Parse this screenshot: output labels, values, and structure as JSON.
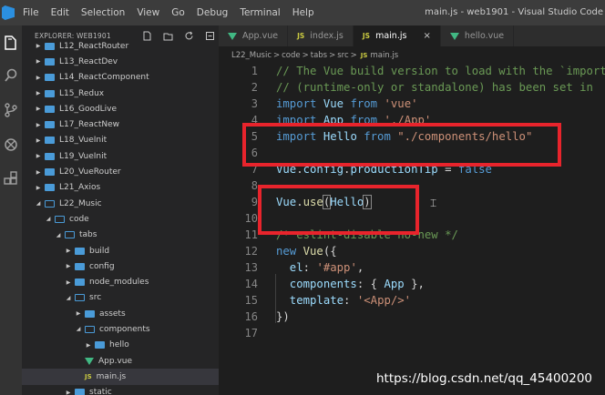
{
  "window": {
    "title": "main.js - web1901 - Visual Studio Code"
  },
  "menu": [
    "File",
    "Edit",
    "Selection",
    "View",
    "Go",
    "Debug",
    "Terminal",
    "Help"
  ],
  "activity_icons": [
    "explorer-icon",
    "search-icon",
    "source-control-icon",
    "debug-icon",
    "extensions-icon"
  ],
  "sidebar": {
    "header": "EXPLORER: WEB1901",
    "actions": [
      "new-file-icon",
      "new-folder-icon",
      "refresh-icon",
      "collapse-icon"
    ],
    "items": [
      {
        "label": "L12_ReactRouter",
        "kind": "folder",
        "open": false,
        "depth": 0
      },
      {
        "label": "L13_ReactDev",
        "kind": "folder",
        "open": false,
        "depth": 0
      },
      {
        "label": "L14_ReactComponent",
        "kind": "folder",
        "open": false,
        "depth": 0
      },
      {
        "label": "L15_Redux",
        "kind": "folder",
        "open": false,
        "depth": 0
      },
      {
        "label": "L16_GoodLive",
        "kind": "folder",
        "open": false,
        "depth": 0
      },
      {
        "label": "L17_ReactNew",
        "kind": "folder",
        "open": false,
        "depth": 0
      },
      {
        "label": "L18_VueInit",
        "kind": "folder",
        "open": false,
        "depth": 0
      },
      {
        "label": "L19_VueInit",
        "kind": "folder",
        "open": false,
        "depth": 0
      },
      {
        "label": "L20_VueRouter",
        "kind": "folder",
        "open": false,
        "depth": 0
      },
      {
        "label": "L21_Axios",
        "kind": "folder",
        "open": false,
        "depth": 0
      },
      {
        "label": "L22_Music",
        "kind": "folder",
        "open": true,
        "depth": 0
      },
      {
        "label": "code",
        "kind": "folder",
        "open": true,
        "depth": 1
      },
      {
        "label": "tabs",
        "kind": "folder",
        "open": true,
        "depth": 2
      },
      {
        "label": "build",
        "kind": "folder",
        "open": false,
        "depth": 3
      },
      {
        "label": "config",
        "kind": "folder",
        "open": false,
        "depth": 3
      },
      {
        "label": "node_modules",
        "kind": "folder",
        "open": false,
        "depth": 3
      },
      {
        "label": "src",
        "kind": "folder",
        "open": true,
        "depth": 3
      },
      {
        "label": "assets",
        "kind": "folder",
        "open": false,
        "depth": 4
      },
      {
        "label": "components",
        "kind": "folder",
        "open": true,
        "depth": 4
      },
      {
        "label": "hello",
        "kind": "folder",
        "open": false,
        "depth": 5
      },
      {
        "label": "App.vue",
        "kind": "vue",
        "open": false,
        "depth": 4
      },
      {
        "label": "main.js",
        "kind": "js",
        "open": false,
        "depth": 4,
        "active": true
      },
      {
        "label": "static",
        "kind": "folder",
        "open": false,
        "depth": 3
      }
    ]
  },
  "tabs": [
    {
      "label": "App.vue",
      "icon": "vue",
      "active": false
    },
    {
      "label": "index.js",
      "icon": "js",
      "active": false
    },
    {
      "label": "main.js",
      "icon": "js",
      "active": true,
      "close": "×"
    },
    {
      "label": "hello.vue",
      "icon": "vue",
      "active": false
    }
  ],
  "breadcrumb": [
    "L22_Music",
    "code",
    "tabs",
    "src",
    "main.js"
  ],
  "breadcrumb_sep": ">",
  "js_badge": "JS",
  "editor": {
    "lines": [
      {
        "n": "1",
        "tokens": [
          {
            "t": "// The Vue build version to load with the `import",
            "c": "comment"
          }
        ]
      },
      {
        "n": "2",
        "tokens": [
          {
            "t": "// (runtime-only or standalone) has been set in",
            "c": "comment"
          }
        ]
      },
      {
        "n": "3",
        "tokens": [
          {
            "t": "import",
            "c": "kw"
          },
          {
            "t": " Vue ",
            "c": "ident"
          },
          {
            "t": "from",
            "c": "kw"
          },
          {
            "t": " 'vue'",
            "c": "str"
          }
        ]
      },
      {
        "n": "4",
        "tokens": [
          {
            "t": "import",
            "c": "kw"
          },
          {
            "t": " App ",
            "c": "ident"
          },
          {
            "t": "from",
            "c": "kw"
          },
          {
            "t": " './App'",
            "c": "str"
          }
        ]
      },
      {
        "n": "5",
        "tokens": [
          {
            "t": "import",
            "c": "kw"
          },
          {
            "t": " Hello ",
            "c": "ident"
          },
          {
            "t": "from",
            "c": "kw"
          },
          {
            "t": " \"./components/hello\"",
            "c": "str"
          }
        ]
      },
      {
        "n": "6",
        "tokens": []
      },
      {
        "n": "7",
        "tokens": [
          {
            "t": "Vue",
            "c": "ident"
          },
          {
            "t": ".",
            "c": "punc"
          },
          {
            "t": "config",
            "c": "ident"
          },
          {
            "t": ".",
            "c": "punc"
          },
          {
            "t": "productionTip",
            "c": "ident"
          },
          {
            "t": " = ",
            "c": "punc"
          },
          {
            "t": "false",
            "c": "kw"
          }
        ]
      },
      {
        "n": "8",
        "tokens": []
      },
      {
        "n": "9",
        "tokens": [
          {
            "t": "Vue",
            "c": "ident"
          },
          {
            "t": ".",
            "c": "punc"
          },
          {
            "t": "use",
            "c": "func"
          },
          {
            "t": "(",
            "c": "punc bracket-box"
          },
          {
            "t": "Hello",
            "c": "ident"
          },
          {
            "t": ")",
            "c": "punc bracket-box"
          }
        ]
      },
      {
        "n": "10",
        "tokens": []
      },
      {
        "n": "11",
        "tokens": [
          {
            "t": "/* eslint-disable no-new */",
            "c": "comment"
          }
        ]
      },
      {
        "n": "12",
        "tokens": [
          {
            "t": "new",
            "c": "kw"
          },
          {
            "t": " ",
            "c": "punc"
          },
          {
            "t": "Vue",
            "c": "func"
          },
          {
            "t": "({",
            "c": "punc"
          }
        ]
      },
      {
        "n": "13",
        "tokens": [
          {
            "t": "  el",
            "c": "ident"
          },
          {
            "t": ": ",
            "c": "punc"
          },
          {
            "t": "'#app'",
            "c": "str"
          },
          {
            "t": ",",
            "c": "punc"
          }
        ]
      },
      {
        "n": "14",
        "tokens": [
          {
            "t": "  components",
            "c": "ident"
          },
          {
            "t": ": { ",
            "c": "punc"
          },
          {
            "t": "App",
            "c": "ident"
          },
          {
            "t": " },",
            "c": "punc"
          }
        ]
      },
      {
        "n": "15",
        "tokens": [
          {
            "t": "  template",
            "c": "ident"
          },
          {
            "t": ": ",
            "c": "punc"
          },
          {
            "t": "'<App/>'",
            "c": "str"
          }
        ]
      },
      {
        "n": "16",
        "tokens": [
          {
            "t": "})",
            "c": "punc"
          }
        ]
      },
      {
        "n": "17",
        "tokens": []
      }
    ]
  },
  "annotations": {
    "box_color": "#e8242c"
  },
  "watermark": "https://blog.csdn.net/qq_45400200",
  "colors": {
    "folder": "#4a9bd8",
    "vue": "#41b883",
    "js": "#cbcb41"
  }
}
